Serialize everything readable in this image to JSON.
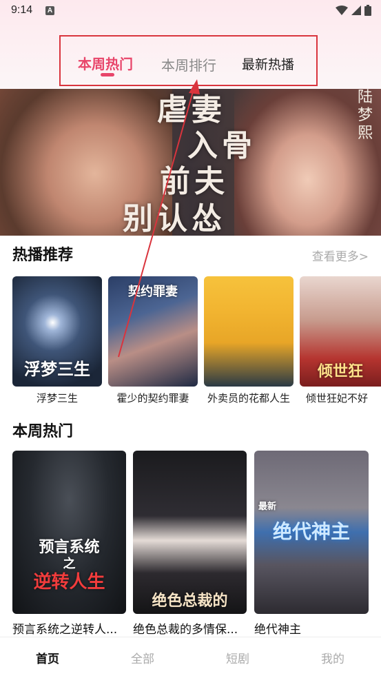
{
  "status_bar": {
    "time": "9:14",
    "notification_letter": "A"
  },
  "tabs": [
    {
      "label": "本周热门",
      "active": true
    },
    {
      "label": "本周排行",
      "active": false
    },
    {
      "label": "最新热播",
      "active": false
    }
  ],
  "banner": {
    "title_lines": [
      "虐妻",
      "入骨",
      "前夫",
      "别认怂"
    ],
    "side_name": "陆梦熙"
  },
  "hot_section": {
    "title": "热播推荐",
    "more_label": "查看更多>",
    "items": [
      {
        "name": "浮梦三生",
        "poster_text": "浮梦三生"
      },
      {
        "name": "霍少的契约罪妻",
        "poster_text": "契约罪妻"
      },
      {
        "name": "外卖员的花都人生",
        "poster_text": ""
      },
      {
        "name": "倾世狂妃不好",
        "poster_text": "倾世狂"
      }
    ]
  },
  "weekly_section": {
    "title": "本周热门",
    "items": [
      {
        "name": "预言系统之逆转人...",
        "poster_line1": "预言系统",
        "poster_line2": "之",
        "poster_line3": "逆转人生"
      },
      {
        "name": "绝色总裁的多情保...",
        "poster_line1": "绝色总裁的"
      },
      {
        "name": "绝代神主",
        "poster_line1": "绝代神主",
        "poster_badge": "最新"
      }
    ]
  },
  "bottom_nav": [
    {
      "label": "首页",
      "active": true
    },
    {
      "label": "全部",
      "active": false
    },
    {
      "label": "短剧",
      "active": false
    },
    {
      "label": "我的",
      "active": false
    }
  ],
  "colors": {
    "accent": "#e8456a",
    "highlight_box": "#d9343d",
    "muted": "#aaaaaa"
  }
}
